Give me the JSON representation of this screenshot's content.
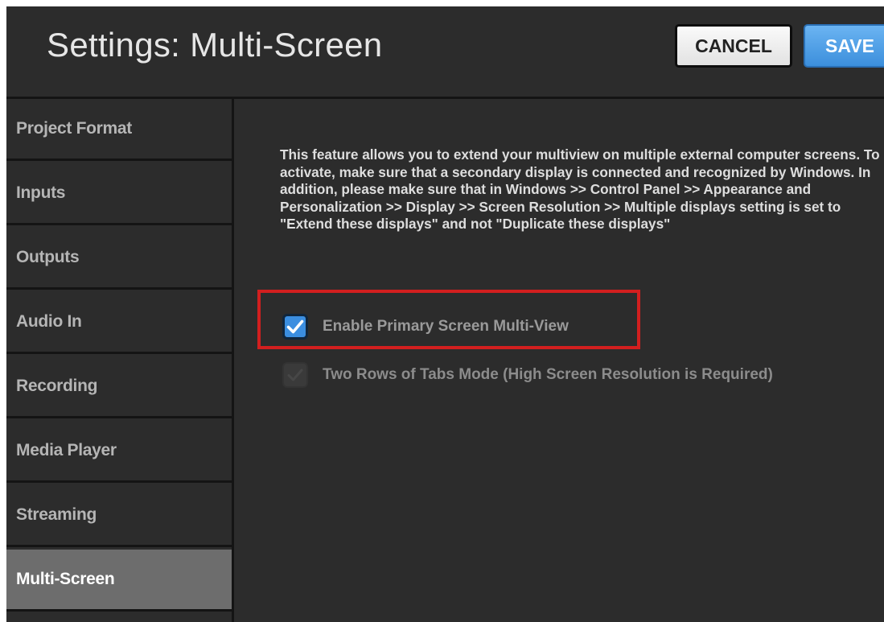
{
  "header": {
    "title": "Settings: Multi-Screen",
    "cancel_label": "CANCEL",
    "save_label": "SAVE"
  },
  "sidebar": {
    "items": [
      {
        "label": "Project Format",
        "active": false
      },
      {
        "label": "Inputs",
        "active": false
      },
      {
        "label": "Outputs",
        "active": false
      },
      {
        "label": "Audio In",
        "active": false
      },
      {
        "label": "Recording",
        "active": false
      },
      {
        "label": "Media Player",
        "active": false
      },
      {
        "label": "Streaming",
        "active": false
      },
      {
        "label": "Multi-Screen",
        "active": true
      }
    ]
  },
  "main": {
    "description": "This feature allows you to extend your multiview on multiple external computer screens. To activate, make sure that a secondary display is connected and recognized by Windows. In addition, please make sure that in Windows >> Control Panel >> Appearance and Personalization >> Display >> Screen Resolution >> Multiple displays setting is set to \"Extend these displays\" and not \"Duplicate these displays\"",
    "options": [
      {
        "label": "Enable Primary Screen Multi-View",
        "checked": true,
        "enabled": true
      },
      {
        "label": "Two Rows of Tabs Mode (High Screen Resolution is Required)",
        "checked": true,
        "enabled": false
      }
    ]
  },
  "colors": {
    "background": "#2c2c2c",
    "active_tab": "#6d6d6d",
    "accent": "#3b8ee0",
    "highlight": "#d21f1f"
  },
  "icons": {
    "checkmark": "checkmark-icon"
  }
}
